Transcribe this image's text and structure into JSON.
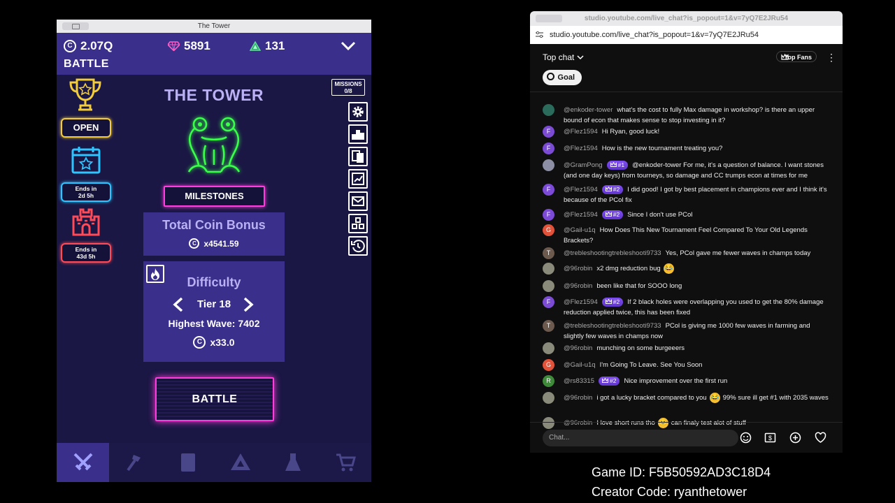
{
  "game": {
    "window_title": "The Tower",
    "coins": "2.07Q",
    "coin_symbol": "C",
    "gems": "5891",
    "medals": "131",
    "mode_label": "BATTLE",
    "open_label": "OPEN",
    "event_ends_1": "Ends in\n2d 5h",
    "event_ends_2": "Ends in\n43d 5h",
    "title": "THE TOWER",
    "milestones_label": "MILESTONES",
    "missions_label": "MISSIONS",
    "missions_count": "0/8",
    "total_coin_bonus_title": "Total Coin Bonus",
    "total_coin_bonus_value": "x4541.59",
    "difficulty_title": "Difficulty",
    "tier_label": "Tier 18",
    "highest_wave_label": "Highest Wave: 7402",
    "difficulty_bonus": "x33.0",
    "battle_button": "BATTLE",
    "colors": {
      "accent": "#ff3cdc",
      "panel": "#3a2f8a",
      "bg": "#1a1744",
      "neon_green": "#3aff4a"
    }
  },
  "chat": {
    "window_title": "studio.youtube.com/live_chat?is_popout=1&v=7yQ7E2JRu54",
    "url": "studio.youtube.com/live_chat?is_popout=1&v=7yQ7E2JRu54",
    "top_chat_label": "Top chat",
    "top_fans_label": "Top Fans",
    "goal_label": "Goal",
    "input_placeholder": "Chat...",
    "messages": [
      {
        "author": "@enkoder-tower",
        "badge": "",
        "text": "what's the cost to fully Max damage in workshop? is there an upper bound of econ that makes sense to stop investing in it?",
        "avatar": "",
        "avatar_color": "#2a6b5c"
      },
      {
        "author": "@Flez1594",
        "badge": "",
        "text": "Hi Ryan, good luck!",
        "avatar": "F",
        "avatar_color": "#7b4bd6"
      },
      {
        "author": "@Flez1594",
        "badge": "",
        "text": "How is the new tournament treating you?",
        "avatar": "F",
        "avatar_color": "#7b4bd6"
      },
      {
        "author": "@GramPong",
        "badge": "#1",
        "text": "@enkoder-tower For me, it's a question of balance. I want stones (and one day keys) from tourneys, so damage and CC trumps econ at times for me",
        "avatar": "",
        "avatar_color": "#8c8fa3"
      },
      {
        "author": "@Flez1594",
        "badge": "#2",
        "text": "I did good! I got by best placement in champions ever and I think it's because of the PCol fix",
        "avatar": "F",
        "avatar_color": "#7b4bd6"
      },
      {
        "author": "@Flez1594",
        "badge": "#2",
        "text": "Since I don't use PCol",
        "avatar": "F",
        "avatar_color": "#7b4bd6"
      },
      {
        "author": "@Gail-u1q",
        "badge": "",
        "text": "How Does This New Tournament Feel Compared To Your Old Legends Brackets?",
        "avatar": "G",
        "avatar_color": "#e0523a"
      },
      {
        "author": "@trebleshootingtrebleshooti9733",
        "badge": "",
        "text": "Yes, PCol gave me fewer waves in champs today",
        "avatar": "T",
        "avatar_color": "#6d5a4f"
      },
      {
        "author": "@96robin",
        "badge": "",
        "text": "x2 dmg reduction bug",
        "emoji": "😂",
        "avatar": "",
        "avatar_color": "#8a8a7a"
      },
      {
        "author": "@96robin",
        "badge": "",
        "text": "been like that for SOOO long",
        "avatar": "",
        "avatar_color": "#8a8a7a"
      },
      {
        "author": "@Flez1594",
        "badge": "#2",
        "text": "If 2 black holes were overlapping you used to get the 80% damage reduction applied twice, this has been fixed",
        "avatar": "F",
        "avatar_color": "#7b4bd6"
      },
      {
        "author": "@trebleshootingtrebleshooti9733",
        "badge": "",
        "text": "PCol is giving me 1000 few waves in farming and slightly few waves in champs now",
        "avatar": "T",
        "avatar_color": "#6d5a4f"
      },
      {
        "author": "@96robin",
        "badge": "",
        "text": "munching on some burgeeers",
        "avatar": "",
        "avatar_color": "#8a8a7a"
      },
      {
        "author": "@Gail-u1q",
        "badge": "",
        "text": "I'm Going To Leave. See You Soon",
        "avatar": "G",
        "avatar_color": "#e0523a"
      },
      {
        "author": "@rs83315",
        "badge": "#2",
        "text": "Nice improvement over the first run",
        "avatar": "R",
        "avatar_color": "#3f8a3a"
      },
      {
        "author": "@96robin",
        "badge": "",
        "text": "i got a lucky bracket compared to you",
        "emoji": "😂",
        "text2": "99% sure ill get #1 with 2035 waves",
        "avatar": "",
        "avatar_color": "#8a8a7a"
      },
      {
        "author": "@96robin",
        "badge": "",
        "text": "I love short runs tho",
        "emoji": "🙂",
        "text2": "can finaly test alot of stuff",
        "avatar": "",
        "avatar_color": "#8a8a7a"
      }
    ]
  },
  "stream": {
    "game_id": "Game ID: F5B50592AD3C18D4",
    "creator_code": "Creator Code: ryanthetower"
  }
}
